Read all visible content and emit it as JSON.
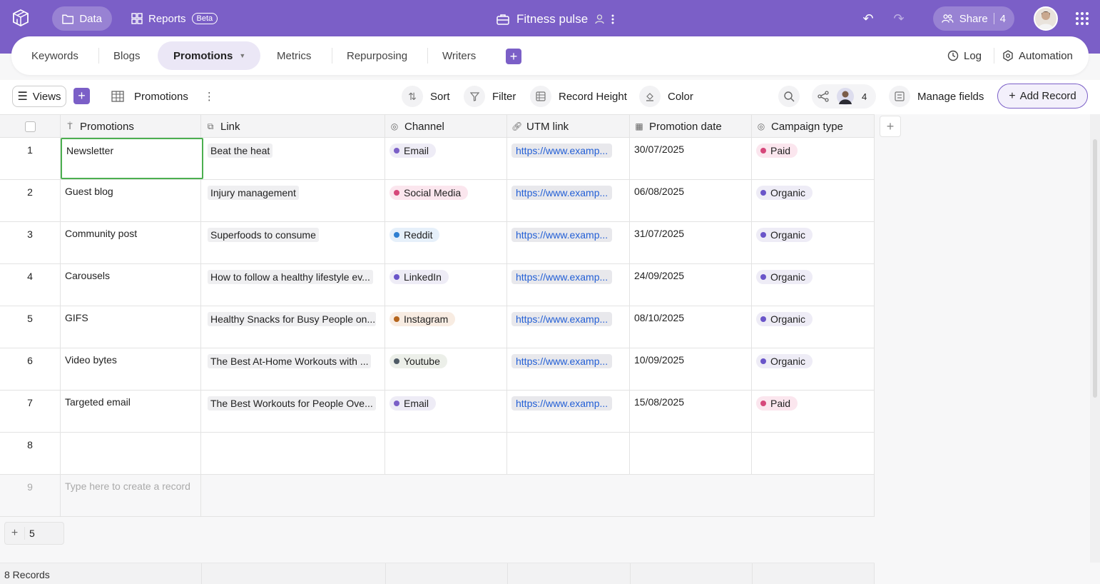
{
  "topbar": {
    "data_label": "Data",
    "reports_label": "Reports",
    "beta_label": "Beta",
    "title": "Fitness pulse",
    "share_label": "Share",
    "share_count": "4"
  },
  "tabs": [
    {
      "label": "Keywords"
    },
    {
      "label": "Blogs"
    },
    {
      "label": "Promotions",
      "active": true
    },
    {
      "label": "Metrics"
    },
    {
      "label": "Repurposing"
    },
    {
      "label": "Writers"
    }
  ],
  "tab_right": {
    "log_label": "Log",
    "automation_label": "Automation"
  },
  "toolbar": {
    "views_label": "Views",
    "view_name": "Promotions",
    "sort_label": "Sort",
    "filter_label": "Filter",
    "record_height_label": "Record Height",
    "color_label": "Color",
    "collab_count": "4",
    "manage_fields_label": "Manage fields",
    "add_record_label": "Add Record"
  },
  "columns": [
    "Promotions",
    "Link",
    "Channel",
    "UTM link",
    "Promotion date",
    "Campaign type"
  ],
  "rows": [
    {
      "n": "1",
      "promotion": "Newsletter",
      "link": "Beat the heat",
      "channel": "Email",
      "utm": "https://www.examp...",
      "date": "30/07/2025",
      "campaign": "Paid"
    },
    {
      "n": "2",
      "promotion": "Guest blog",
      "link": "Injury management",
      "channel": "Social Media",
      "utm": "https://www.examp...",
      "date": "06/08/2025",
      "campaign": "Organic"
    },
    {
      "n": "3",
      "promotion": "Community post",
      "link": "Superfoods to consume",
      "channel": "Reddit",
      "utm": "https://www.examp...",
      "date": "31/07/2025",
      "campaign": "Organic"
    },
    {
      "n": "4",
      "promotion": "Carousels",
      "link": "How to follow a healthy lifestyle ev...",
      "channel": "LinkedIn",
      "utm": "https://www.examp...",
      "date": "24/09/2025",
      "campaign": "Organic"
    },
    {
      "n": "5",
      "promotion": "GIFS",
      "link": "Healthy Snacks for Busy People on...",
      "channel": "Instagram",
      "utm": "https://www.examp...",
      "date": "08/10/2025",
      "campaign": "Organic"
    },
    {
      "n": "6",
      "promotion": "Video bytes",
      "link": "The Best At-Home Workouts with ...",
      "channel": "Youtube",
      "utm": "https://www.examp...",
      "date": "10/09/2025",
      "campaign": "Organic"
    },
    {
      "n": "7",
      "promotion": "Targeted email",
      "link": "The Best Workouts for People Ove...",
      "channel": "Email",
      "utm": "https://www.examp...",
      "date": "15/08/2025",
      "campaign": "Paid"
    }
  ],
  "empty_row_number": "8",
  "new_row": {
    "number": "9",
    "placeholder": "Type here to create a record"
  },
  "group_count": "5",
  "footer": {
    "records": "8 Records"
  },
  "colors": {
    "accent": "#7b5fc7",
    "email": "#7b5fc7",
    "social_media": "#d6477a",
    "reddit": "#2f7fd1",
    "linkedin": "#6a55c9",
    "instagram": "#b5651d",
    "youtube": "#4f5b66",
    "paid": "#d6477a",
    "organic": "#6a55c9",
    "active_cell": "#4caf50"
  }
}
